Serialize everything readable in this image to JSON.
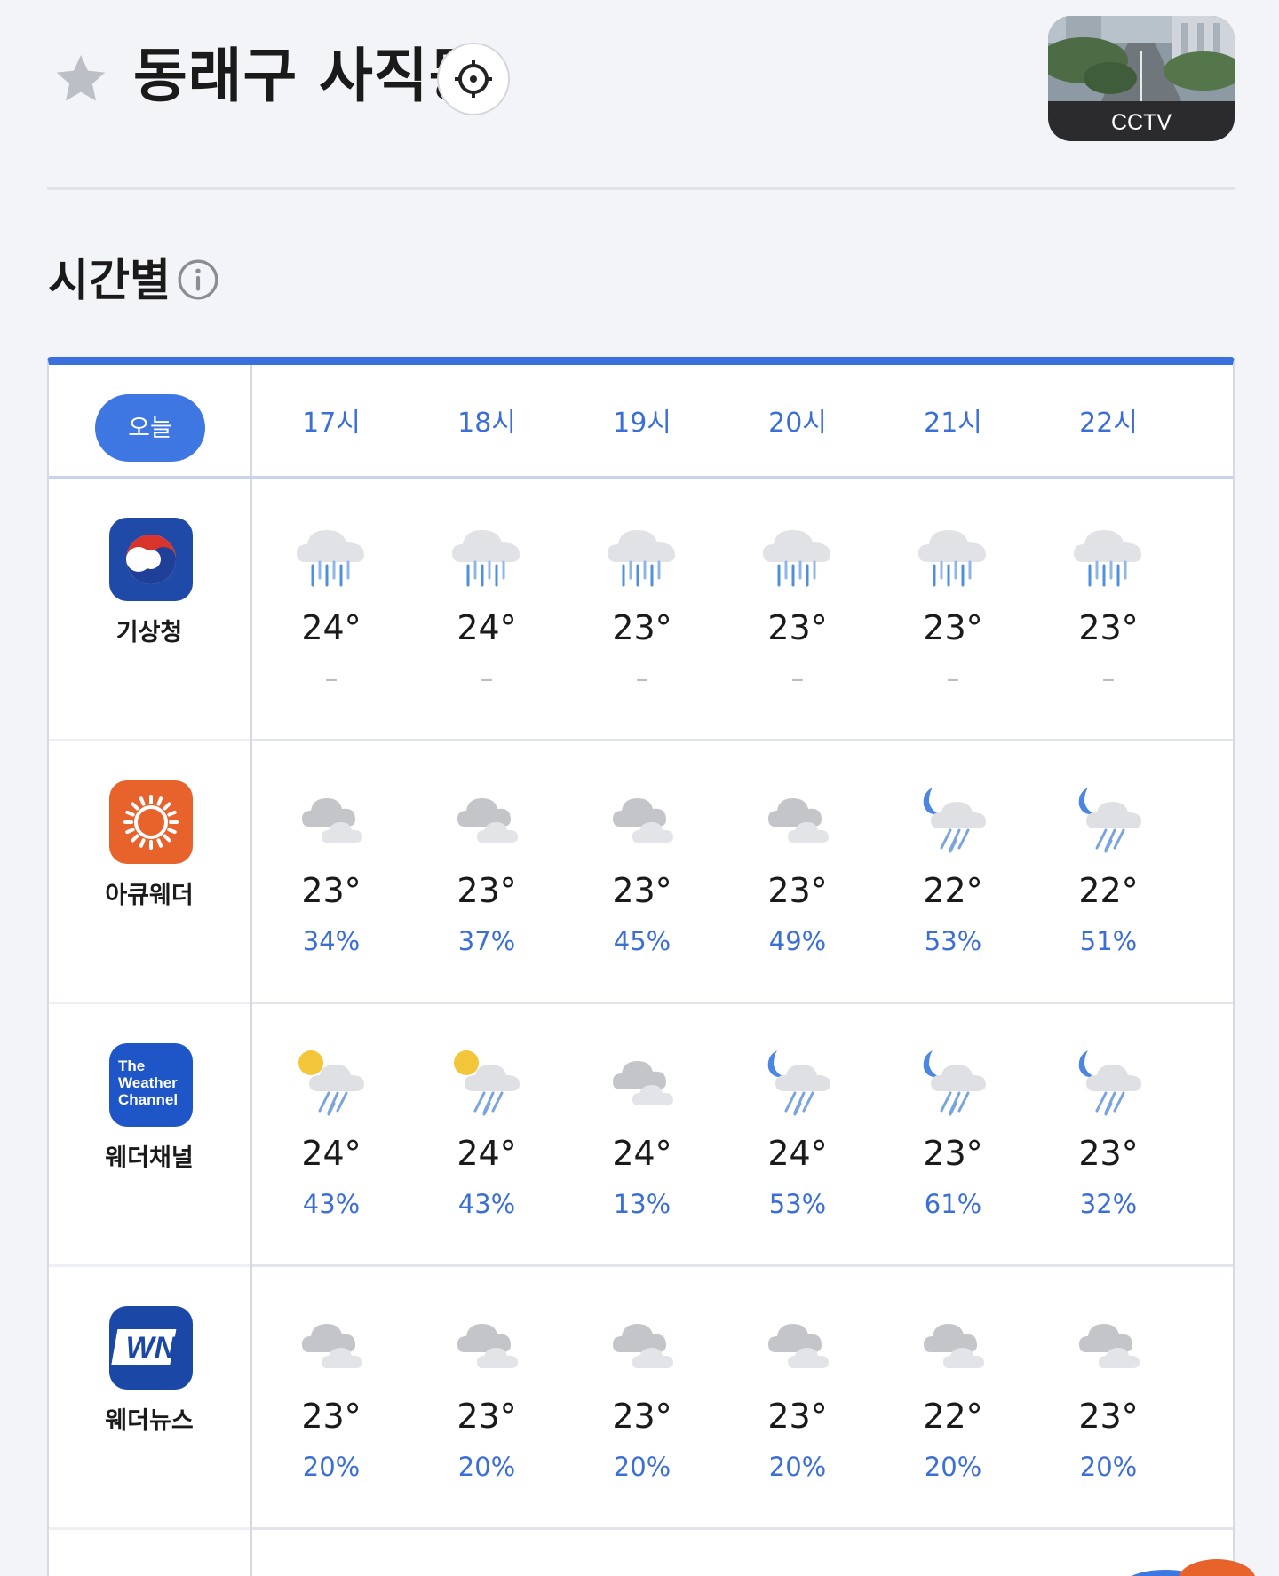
{
  "header": {
    "location": "동래구 사직동",
    "cctv_label": "CCTV"
  },
  "section": {
    "title": "시간별"
  },
  "table": {
    "today_label": "오늘",
    "hours": [
      "17시",
      "18시",
      "19시",
      "20시",
      "21시",
      "22시"
    ],
    "providers": [
      {
        "name": "기상청",
        "logo": "kma-logo",
        "forecasts": [
          {
            "icon": "rain-cloud-icon",
            "temp": "24°",
            "pop": "–"
          },
          {
            "icon": "rain-cloud-icon",
            "temp": "24°",
            "pop": "–"
          },
          {
            "icon": "rain-cloud-icon",
            "temp": "23°",
            "pop": "–"
          },
          {
            "icon": "rain-cloud-icon",
            "temp": "23°",
            "pop": "–"
          },
          {
            "icon": "rain-cloud-icon",
            "temp": "23°",
            "pop": "–"
          },
          {
            "icon": "rain-cloud-icon",
            "temp": "23°",
            "pop": "–"
          }
        ]
      },
      {
        "name": "아큐웨더",
        "logo": "accuweather-logo",
        "forecasts": [
          {
            "icon": "cloudy-icon",
            "temp": "23°",
            "pop": "34%"
          },
          {
            "icon": "cloudy-icon",
            "temp": "23°",
            "pop": "37%"
          },
          {
            "icon": "cloudy-icon",
            "temp": "23°",
            "pop": "45%"
          },
          {
            "icon": "cloudy-icon",
            "temp": "23°",
            "pop": "49%"
          },
          {
            "icon": "night-rain-icon",
            "temp": "22°",
            "pop": "53%"
          },
          {
            "icon": "night-rain-icon",
            "temp": "22°",
            "pop": "51%"
          }
        ]
      },
      {
        "name": "웨더채널",
        "logo": "weather-channel-logo",
        "logo_text": [
          "The",
          "Weather",
          "Channel"
        ],
        "forecasts": [
          {
            "icon": "sun-rain-icon",
            "temp": "24°",
            "pop": "43%"
          },
          {
            "icon": "sun-rain-icon",
            "temp": "24°",
            "pop": "43%"
          },
          {
            "icon": "cloudy-icon",
            "temp": "24°",
            "pop": "13%"
          },
          {
            "icon": "night-rain-icon",
            "temp": "24°",
            "pop": "53%"
          },
          {
            "icon": "night-rain-icon",
            "temp": "23°",
            "pop": "61%"
          },
          {
            "icon": "night-rain-icon",
            "temp": "23°",
            "pop": "32%"
          }
        ]
      },
      {
        "name": "웨더뉴스",
        "logo": "weathernews-logo",
        "logo_text": "WN",
        "forecasts": [
          {
            "icon": "cloudy-icon",
            "temp": "23°",
            "pop": "20%"
          },
          {
            "icon": "cloudy-icon",
            "temp": "23°",
            "pop": "20%"
          },
          {
            "icon": "cloudy-icon",
            "temp": "23°",
            "pop": "20%"
          },
          {
            "icon": "cloudy-icon",
            "temp": "23°",
            "pop": "20%"
          },
          {
            "icon": "cloudy-icon",
            "temp": "22°",
            "pop": "20%"
          },
          {
            "icon": "cloudy-icon",
            "temp": "23°",
            "pop": "20%"
          }
        ]
      }
    ]
  },
  "colors": {
    "accent": "#3e76e2",
    "pop_text": "#3c6fd6",
    "accuweather": "#e8622c",
    "kma": "#1f4aa8",
    "twc": "#1f56c7",
    "wn": "#1b47a6"
  }
}
